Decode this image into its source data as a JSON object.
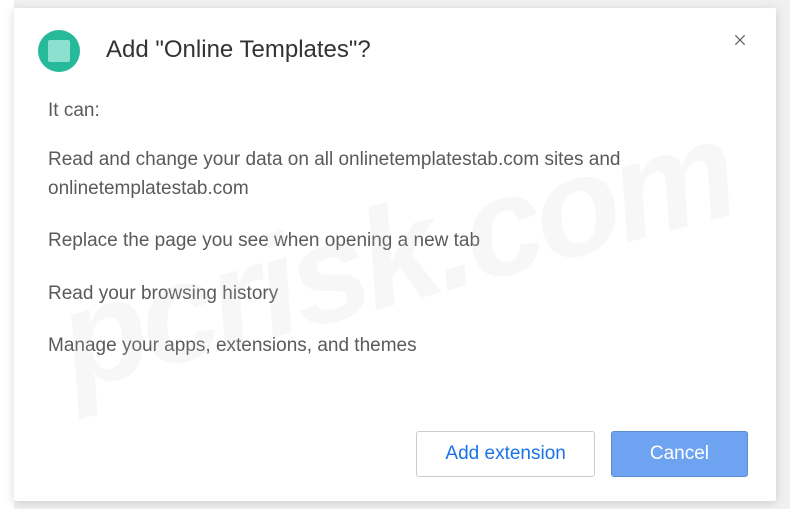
{
  "dialog": {
    "title": "Add \"Online Templates\"?",
    "intro": "It can:",
    "permissions": [
      "Read and change your data on all onlinetemplatestab.com sites and onlinetemplatestab.com",
      "Replace the page you see when opening a new tab",
      "Read your browsing history",
      "Manage your apps, extensions, and themes"
    ],
    "buttons": {
      "add": "Add extension",
      "cancel": "Cancel"
    }
  },
  "watermark": "pcrisk.com"
}
